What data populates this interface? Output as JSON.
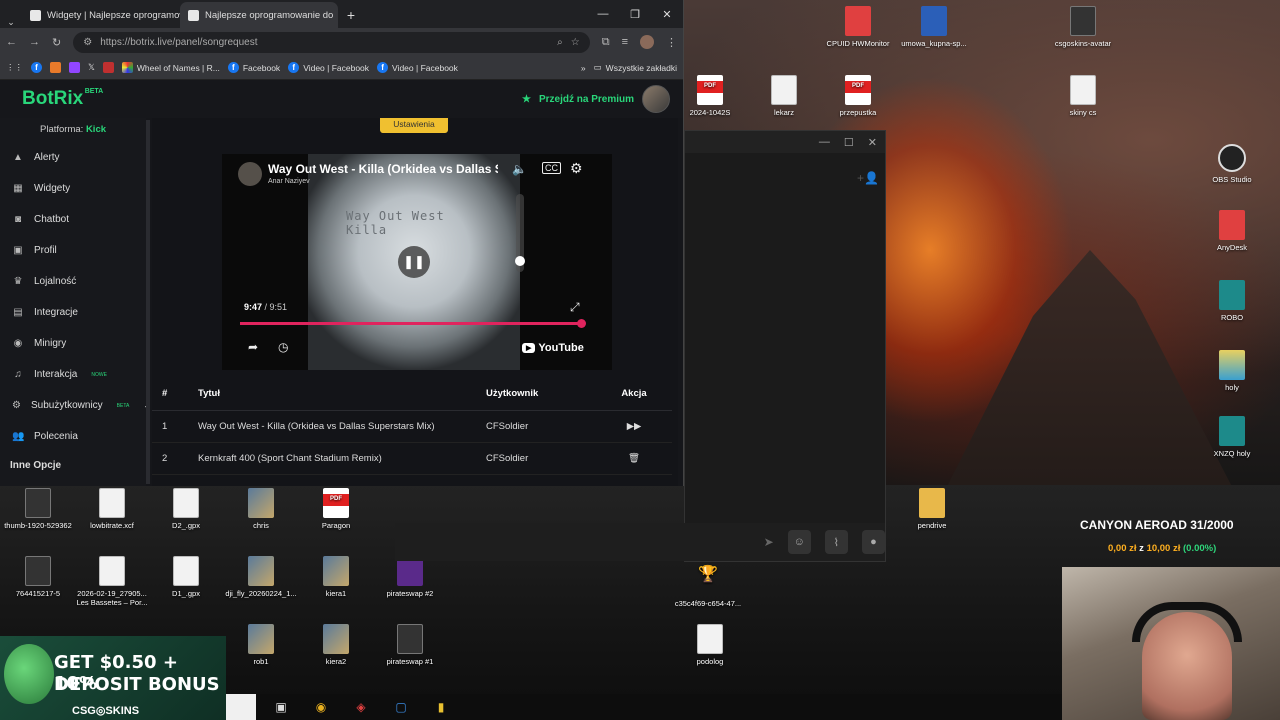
{
  "browser": {
    "tabs": [
      {
        "label": "Widgety | Najlepsze oprogramowa"
      },
      {
        "label": "Najlepsze oprogramowanie do"
      }
    ],
    "url": "https://botrix.live/panel/songrequest",
    "bookmarks": [
      "Wheel of Names | R...",
      "Facebook",
      "Video | Facebook",
      "Video | Facebook"
    ],
    "all_bookmarks": "Wszystkie zakładki"
  },
  "app": {
    "logo": "BotRix",
    "logo_badge": "BETA",
    "premium": "Przejdź na Premium",
    "platform_label": "Platforma:",
    "platform_value": "Kick",
    "menu": [
      {
        "label": "Alerty",
        "icon": "alert-icon"
      },
      {
        "label": "Widgety",
        "icon": "grid-icon"
      },
      {
        "label": "Chatbot",
        "icon": "robot-icon"
      },
      {
        "label": "Profil",
        "icon": "profile-icon"
      },
      {
        "label": "Lojalność",
        "icon": "trophy-icon"
      },
      {
        "label": "Integracje",
        "icon": "integration-icon"
      },
      {
        "label": "Minigry",
        "icon": "gamepad-icon"
      },
      {
        "label": "Interakcja",
        "icon": "music-icon",
        "badge": "NOWE"
      },
      {
        "label": "Subużytkownicy",
        "icon": "users-icon",
        "badge": "BETA"
      },
      {
        "label": "Polecenia",
        "icon": "referral-icon"
      }
    ],
    "other_options": "Inne Opcje",
    "settings_button": "Ustawienia"
  },
  "player": {
    "title": "Way Out West - Killa (Orkidea vs Dallas Sup",
    "channel": "Anar Naziyev",
    "time_current": "9:47",
    "time_total": "/ 9:51",
    "progress": 0.99,
    "volume": 0.2,
    "disc_line1": "Way Out West",
    "disc_line2": "Killa",
    "youtube": "YouTube"
  },
  "queue": {
    "headers": [
      "#",
      "Tytuł",
      "Użytkownik",
      "Akcja"
    ],
    "rows": [
      {
        "n": "1",
        "title": "Way Out West - Killa (Orkidea vs Dallas Superstars Mix)",
        "user": "CFSoldier",
        "action": "play-next-icon"
      },
      {
        "n": "2",
        "title": "Kernkraft 400 (Sport Chant Stadium Remix)",
        "user": "CFSoldier",
        "action": "delete-icon"
      }
    ]
  },
  "desktop": {
    "icons": [
      {
        "label": "CPUID HWMonitor"
      },
      {
        "label": "umowa_kupna-sp..."
      },
      {
        "label": "csgoskins-avatar"
      },
      {
        "label": "2024-1042S"
      },
      {
        "label": "lekarz"
      },
      {
        "label": "przepustka"
      },
      {
        "label": "skiny cs"
      },
      {
        "label": "OBS Studio"
      },
      {
        "label": "AnyDesk"
      },
      {
        "label": "ROBO"
      },
      {
        "label": "holy"
      },
      {
        "label": "XNZQ holy"
      },
      {
        "label": "thumb-1920-529362"
      },
      {
        "label": "lowbitrate.xcf"
      },
      {
        "label": "D2_.gpx"
      },
      {
        "label": "chris"
      },
      {
        "label": "Paragon"
      },
      {
        "label": "764415217-5"
      },
      {
        "label": "2026-02-19_27905... Les Bassetes – Por..."
      },
      {
        "label": "D1_.gpx"
      },
      {
        "label": "dji_fly_20260224_1..."
      },
      {
        "label": "kiera1"
      },
      {
        "label": "pirateswap #2"
      },
      {
        "label": "c35c4f69-c654-47..."
      },
      {
        "label": "rob1"
      },
      {
        "label": "kiera2"
      },
      {
        "label": "pirateswap #1"
      },
      {
        "label": "podolog"
      },
      {
        "label": "pendrive"
      }
    ]
  },
  "overlay": {
    "goal_title": "CANYON AEROAD 31/2000",
    "goal_current": "0,00 zł",
    "goal_sep": "z",
    "goal_target": "10,00 zł",
    "goal_percent": "(0.00%)",
    "banner_line1": "GET $0.50 + 10%",
    "banner_line2": "DEPOSIT BONUS",
    "banner_brand": "CSG◎SKINS"
  }
}
